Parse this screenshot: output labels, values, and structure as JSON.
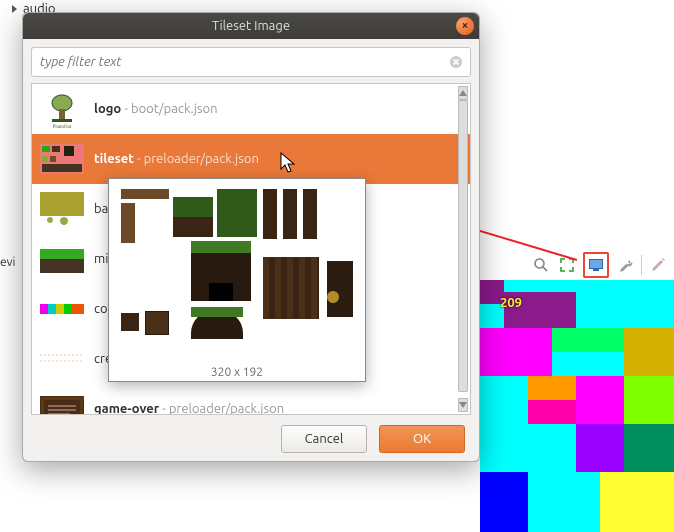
{
  "tree": {
    "item": "audio"
  },
  "devices_label": "evi",
  "toolbar": {
    "zoom_icon": "zoom-icon",
    "fit_icon": "fit-icon",
    "display_icon": "display-icon",
    "wrench_icon": "wrench-icon",
    "pencil_icon": "pencil-icon"
  },
  "dialog": {
    "title": "Tileset Image",
    "filter_placeholder": "type filter text",
    "cancel": "Cancel",
    "ok": "OK",
    "items": [
      {
        "name": "logo",
        "path": "boot/pack.json"
      },
      {
        "name": "tileset",
        "path": "preloader/pack.json"
      },
      {
        "name": "ba"
      },
      {
        "name": "mi"
      },
      {
        "name": "co"
      },
      {
        "name": "cre"
      },
      {
        "name": "game-over",
        "path": "preloader/pack.json"
      }
    ]
  },
  "preview": {
    "dimensions": "320 x 192"
  },
  "canvas_label": "209"
}
